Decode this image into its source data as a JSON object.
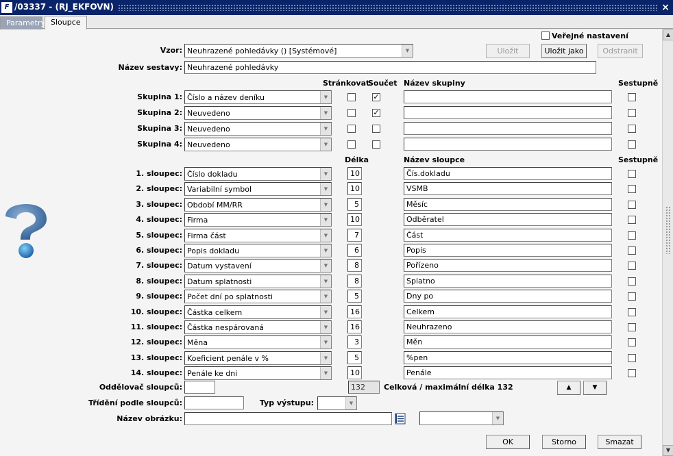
{
  "window": {
    "title": "/03337 - (RJ_EKFOVN)",
    "icon": "application-icon",
    "close": "×"
  },
  "tabs": [
    {
      "label": "Parametry",
      "active": false
    },
    {
      "label": "Sloupce",
      "active": true
    }
  ],
  "public_setting": {
    "label": "Veřejné nastavení",
    "checked": false
  },
  "vzor": {
    "label": "Vzor:",
    "value": "Neuhrazené pohledávky   ()   [Systémové]"
  },
  "buttons": {
    "save": "Uložit",
    "save_as": "Uložit jako",
    "remove": "Odstranit",
    "ok": "OK",
    "cancel": "Storno",
    "delete": "Smazat",
    "up": "▲",
    "down": "▼"
  },
  "report_name": {
    "label": "Název sestavy:",
    "value": "Neuhrazené pohledávky"
  },
  "group_headers": {
    "paging": "Stránkovat",
    "sum": "Součet",
    "group_name": "Název skupiny",
    "descending": "Sestupně"
  },
  "groups": [
    {
      "label": "Skupina 1:",
      "value": "Číslo a název deníku",
      "paging": false,
      "sum": true,
      "name": "",
      "desc": false
    },
    {
      "label": "Skupina 2:",
      "value": "Neuvedeno",
      "paging": false,
      "sum": true,
      "name": "",
      "desc": false
    },
    {
      "label": "Skupina 3:",
      "value": "Neuvedeno",
      "paging": false,
      "sum": false,
      "name": "",
      "desc": false
    },
    {
      "label": "Skupina 4:",
      "value": "Neuvedeno",
      "paging": false,
      "sum": false,
      "name": "",
      "desc": false
    }
  ],
  "column_headers": {
    "length": "Délka",
    "column_name": "Název sloupce",
    "descending": "Sestupně"
  },
  "columns": [
    {
      "label": "1. sloupec:",
      "value": "Číslo dokladu",
      "length": "10",
      "name": "Čís.dokladu",
      "desc": false
    },
    {
      "label": "2. sloupec:",
      "value": "Variabilní symbol",
      "length": "10",
      "name": "VSMB",
      "desc": false
    },
    {
      "label": "3. sloupec:",
      "value": "Období MM/RR",
      "length": "5",
      "name": "Měsíc",
      "desc": false
    },
    {
      "label": "4. sloupec:",
      "value": "Firma",
      "length": "10",
      "name": "Odběratel",
      "desc": false
    },
    {
      "label": "5. sloupec:",
      "value": "Firma část",
      "length": "7",
      "name": "Část",
      "desc": false
    },
    {
      "label": "6. sloupec:",
      "value": "Popis dokladu",
      "length": "6",
      "name": "Popis",
      "desc": false
    },
    {
      "label": "7. sloupec:",
      "value": "Datum vystavení",
      "length": "8",
      "name": "Pořízeno",
      "desc": false
    },
    {
      "label": "8. sloupec:",
      "value": "Datum splatnosti",
      "length": "8",
      "name": "Splatno",
      "desc": false
    },
    {
      "label": "9. sloupec:",
      "value": "Počet dní po splatnosti",
      "length": "5",
      "name": "Dny po",
      "desc": false
    },
    {
      "label": "10. sloupec:",
      "value": "Částka celkem",
      "length": "16",
      "name": "Celkem",
      "desc": false
    },
    {
      "label": "11. sloupec:",
      "value": "Částka nespárovaná",
      "length": "16",
      "name": "Neuhrazeno",
      "desc": false
    },
    {
      "label": "12. sloupec:",
      "value": "Měna",
      "length": "3",
      "name": "Měn",
      "desc": false
    },
    {
      "label": "13. sloupec:",
      "value": "Koeficient penále v %",
      "length": "5",
      "name": "%pen",
      "desc": false
    },
    {
      "label": "14. sloupec:",
      "value": "Penále ke dni",
      "length": "10",
      "name": "Penále",
      "desc": false
    }
  ],
  "separator": {
    "label": "Oddělovač sloupců:",
    "value": ""
  },
  "total": {
    "value": "132",
    "label": "Celková / maximální délka 132"
  },
  "sort": {
    "label": "Třídění podle sloupců:",
    "value": ""
  },
  "output_type": {
    "label": "Typ výstupu:",
    "value": ""
  },
  "image_name": {
    "label": "Název obrázku:",
    "value": "",
    "extra_value": ""
  },
  "icons": {
    "help": "help-question-icon",
    "browse": "list-browse-icon"
  },
  "colors": {
    "titlebar": "#0a246a",
    "panel": "#f4f4f4",
    "help": "#2f5d93"
  }
}
